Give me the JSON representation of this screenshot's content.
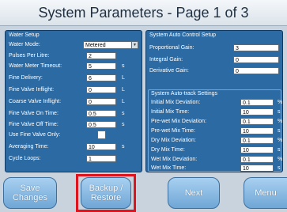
{
  "title": "System Parameters - Page 1 of 3",
  "water_setup": {
    "header": "Water Setup",
    "water_mode_label": "Water Mode:",
    "water_mode_value": "Metered",
    "pulses_label": "Pulses Per Litre:",
    "pulses_value": "2",
    "meter_timeout_label": "Water Meter Timeout:",
    "meter_timeout_value": "5",
    "meter_timeout_unit": "s",
    "fine_delivery_label": "Fine Delivery:",
    "fine_delivery_value": "6",
    "fine_delivery_unit": "L",
    "fine_inflight_label": "Fine Valve Inflight:",
    "fine_inflight_value": "0",
    "fine_inflight_unit": "L",
    "coarse_inflight_label": "Coarse Valve Inflight:",
    "coarse_inflight_value": "0",
    "coarse_inflight_unit": "L",
    "fine_on_label": "Fine Valve On Time:",
    "fine_on_value": "0.5",
    "fine_on_unit": "s",
    "fine_off_label": "Fine Valve Off Time:",
    "fine_off_value": "0.5",
    "fine_off_unit": "s",
    "use_fine_only_label": "Use Fine Valve Only:",
    "averaging_label": "Averaging Time:",
    "averaging_value": "10",
    "averaging_unit": "s",
    "cycle_loops_label": "Cycle Loops:",
    "cycle_loops_value": "1"
  },
  "auto_control": {
    "header": "System Auto Control Setup",
    "prop_gain_label": "Proportional Gain:",
    "prop_gain_value": "3",
    "int_gain_label": "Integral Gain:",
    "int_gain_value": "0",
    "deriv_gain_label": "Derivative Gain:",
    "deriv_gain_value": "0"
  },
  "auto_track": {
    "header": "System Auto-track Settings",
    "rows": [
      {
        "label": "Initial Mix Deviation:",
        "value": "0.1",
        "unit": "%"
      },
      {
        "label": "Initial Mix Time:",
        "value": "10",
        "unit": "s"
      },
      {
        "label": "Pre-wet Mix Deviation:",
        "value": "0.1",
        "unit": "%"
      },
      {
        "label": "Pre-wet Mix Time:",
        "value": "10",
        "unit": "s"
      },
      {
        "label": "Dry Mix Deviation:",
        "value": "0.1",
        "unit": "%"
      },
      {
        "label": "Dry Mix Time:",
        "value": "10",
        "unit": "s"
      },
      {
        "label": "Wet Mix Deviation:",
        "value": "0.1",
        "unit": "%"
      },
      {
        "label": "Wet Mix Time:",
        "value": "10",
        "unit": "s"
      }
    ]
  },
  "buttons": {
    "save_line1": "Save",
    "save_line2": "Changes",
    "backup_line1": "Backup /",
    "backup_line2": "Restore",
    "next": "Next",
    "menu": "Menu"
  },
  "colors": {
    "panel": "#2b6aa3",
    "highlight": "#e0121c"
  }
}
